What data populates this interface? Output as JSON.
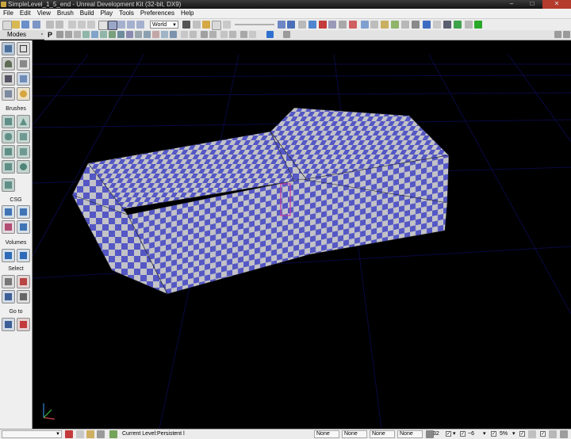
{
  "window": {
    "title": "SimpleLevel_1_5_end - Unreal Development Kit (32-bit, DX9)",
    "minimize": "–",
    "maximize": "□",
    "close": "✕"
  },
  "menu": [
    "File",
    "Edit",
    "View",
    "Brush",
    "Build",
    "Play",
    "Tools",
    "Preferences",
    "Help"
  ],
  "toolbar": {
    "coordinate_system": "World"
  },
  "modes": {
    "title": "Modes",
    "pin": "▫",
    "sections": [
      "Brushes",
      "CSG",
      "Volumes",
      "Select",
      "Go to"
    ]
  },
  "viewport_toolbar": {
    "perspective_label": "P"
  },
  "status": {
    "current_level_label": "Current Level:",
    "current_level_value": "Persistent l",
    "fields": [
      "None",
      "None",
      "None",
      "None"
    ],
    "grid_value": "32",
    "rotation_value": "~6",
    "scale_value": "5%"
  },
  "colors": {
    "checker_blue": "#5457c4",
    "checker_grey": "#c2c2c8",
    "grid_line": "#0b0b4a",
    "window_chrome": "#1e1e1e",
    "panel_bg": "#efefef"
  }
}
